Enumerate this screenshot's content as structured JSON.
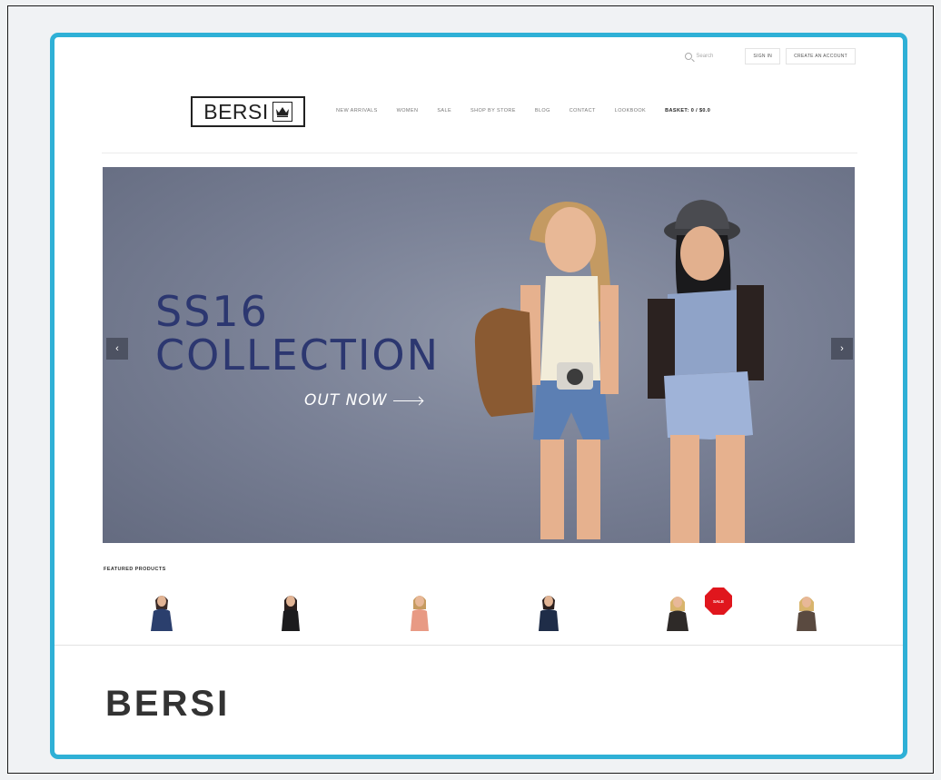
{
  "topbar": {
    "search_placeholder": "Search",
    "sign_in": "SIGN IN",
    "create_account": "CREATE AN ACCOUNT"
  },
  "header": {
    "logo_text": "BERSI",
    "nav": [
      "NEW ARRIVALS",
      "WOMEN",
      "SALE",
      "SHOP BY STORE",
      "BLOG",
      "CONTACT",
      "LOOKBOOK",
      "BASKET: 0 / $0.0"
    ]
  },
  "hero": {
    "title_line1": "SS16",
    "title_line2": "COLLECTION",
    "subtitle": "OUT NOW",
    "prev_arrow": "‹",
    "next_arrow": "›"
  },
  "featured": {
    "label": "FEATURED PRODUCTS",
    "sale_badge": "SALE"
  },
  "brand": {
    "title": "BERSI"
  },
  "colors": {
    "accent_border": "#2fb0d6",
    "hero_title": "#2c3770",
    "sale_red": "#e0161d"
  }
}
